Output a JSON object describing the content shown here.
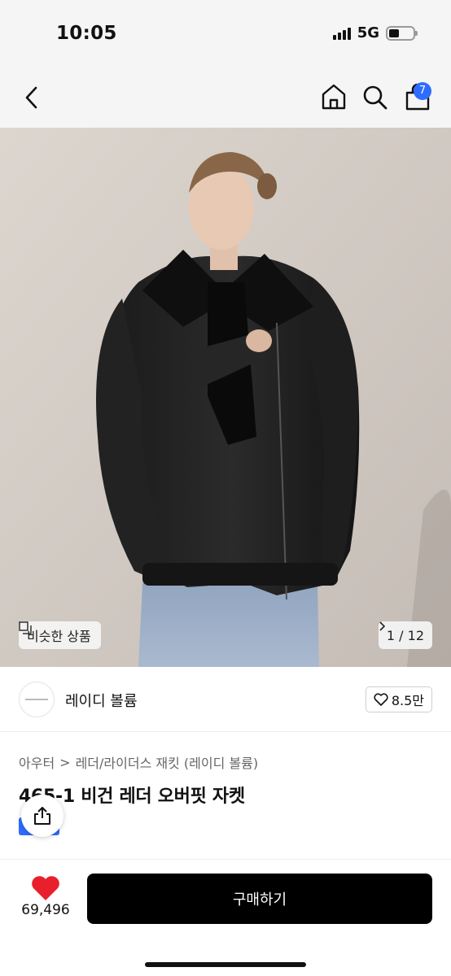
{
  "status_bar": {
    "time": "10:05",
    "network": "5G"
  },
  "nav": {
    "cart_count": "7"
  },
  "gallery": {
    "similar_label": "비슷한 상품",
    "counter": "1 / 12"
  },
  "brand": {
    "name": "레이디 볼륨",
    "likes": "8.5만"
  },
  "breadcrumb": {
    "category": "아우터",
    "separator": ">",
    "subcategory": "레더/라이더스 재킷 (레이디 볼륨)"
  },
  "product": {
    "title": "465-1 비건 레더 오버핏 자켓"
  },
  "bottom_bar": {
    "like_count": "69,496",
    "buy_label": "구매하기"
  },
  "colors": {
    "accent": "#2e6bff",
    "like_red": "#e8202c",
    "buy_bg": "#000000"
  }
}
